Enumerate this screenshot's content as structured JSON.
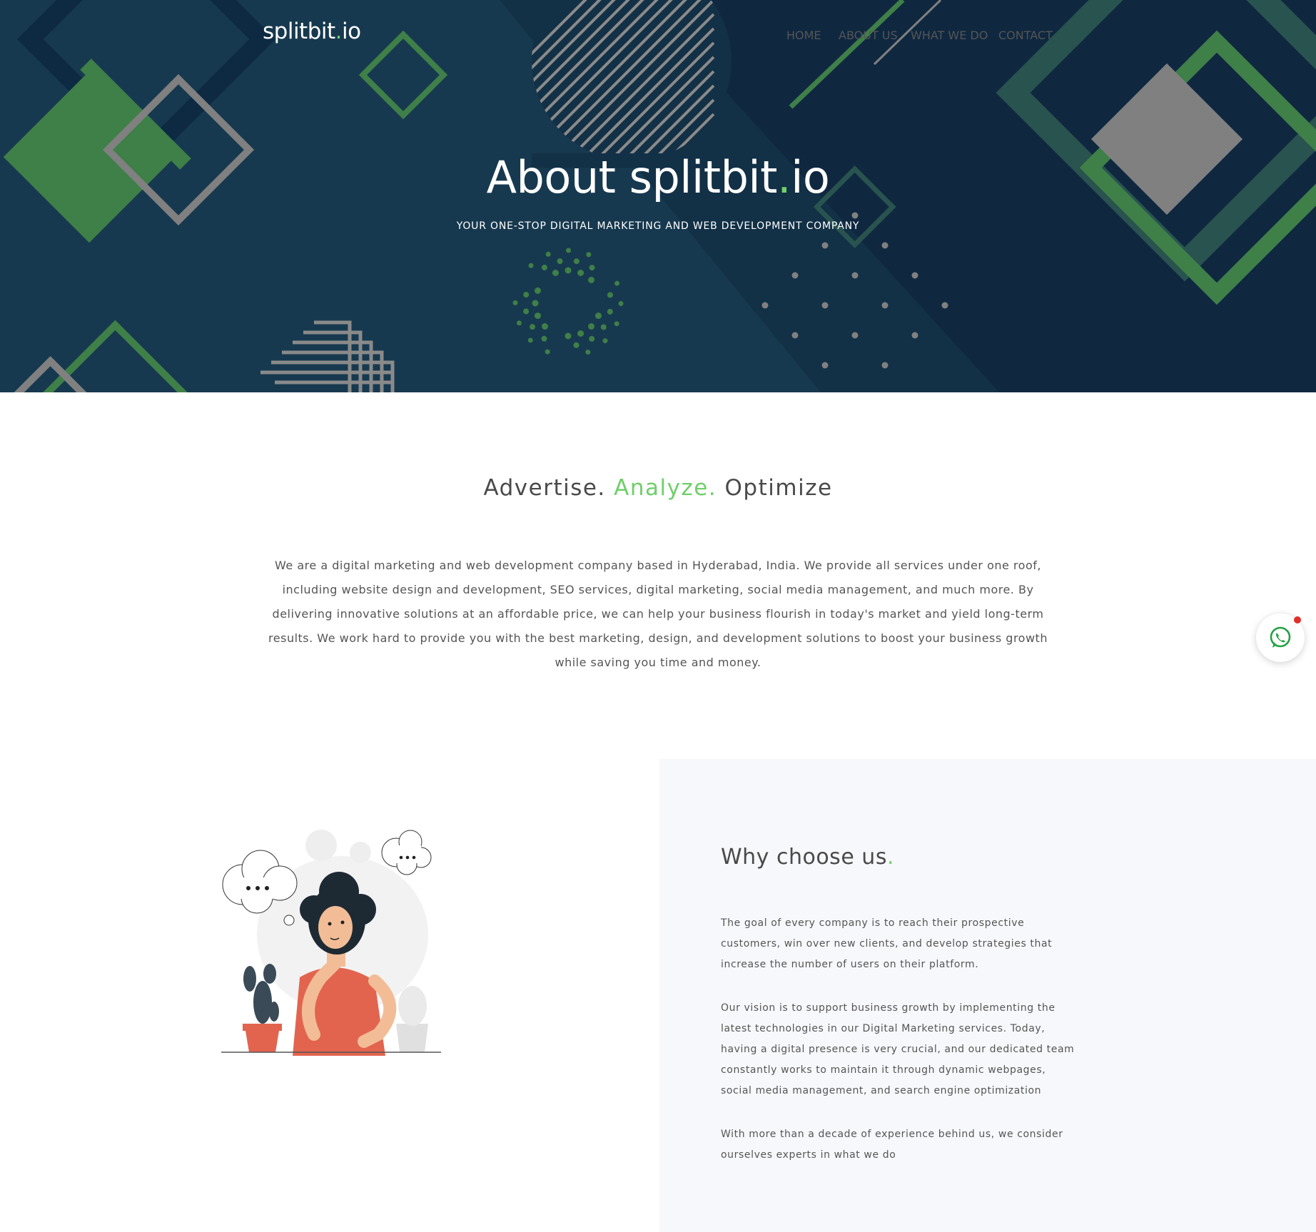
{
  "header": {
    "logo_main": "splitbit",
    "logo_dot": ".",
    "logo_tail": "io",
    "nav": [
      "HOME",
      "ABOUT US",
      "WHAT WE DO",
      "CONTACT"
    ]
  },
  "hero": {
    "title_main": "About splitbit",
    "title_dot": ".",
    "title_tail": "io",
    "subtitle": "YOUR ONE-STOP DIGITAL MARKETING AND WEB DEVELOPMENT COMPANY"
  },
  "about": {
    "tag_1": "Advertise.",
    "tag_2": "Analyze.",
    "tag_3": "Optimize",
    "body": "We are a digital marketing and web development company based in Hyderabad, India. We provide all services under one roof, including website design and development, SEO services, digital marketing, social media management, and much more. By delivering innovative solutions at an affordable price, we can help your business flourish in today's market and yield long-term results. We work hard to provide you with the best marketing, design, and development solutions to boost your business growth while saving you time and money."
  },
  "why": {
    "title": "Why choose us",
    "title_dot": ".",
    "p1": "The goal of every company is to reach their prospective customers, win over new clients, and develop strategies that increase the number of users on their platform.",
    "p2": "Our vision is to support business growth by implementing the latest technologies in our Digital Marketing services. Today, having a digital presence is very crucial, and our dedicated team constantly works to maintain it through dynamic webpages, social media management, and search engine optimization",
    "p3": "With more than a decade of experience behind us, we consider ourselves experts in what we do"
  },
  "colors": {
    "hero_bg": "#123046",
    "accent_green": "#6fcf6a",
    "shape_green": "#3f7f48",
    "shape_gray": "#808080",
    "panel_bg": "#f7f8fc",
    "whatsapp_green": "#25a244",
    "notify_red": "#e0302a"
  },
  "icons": {
    "whatsapp": "whatsapp-icon"
  }
}
